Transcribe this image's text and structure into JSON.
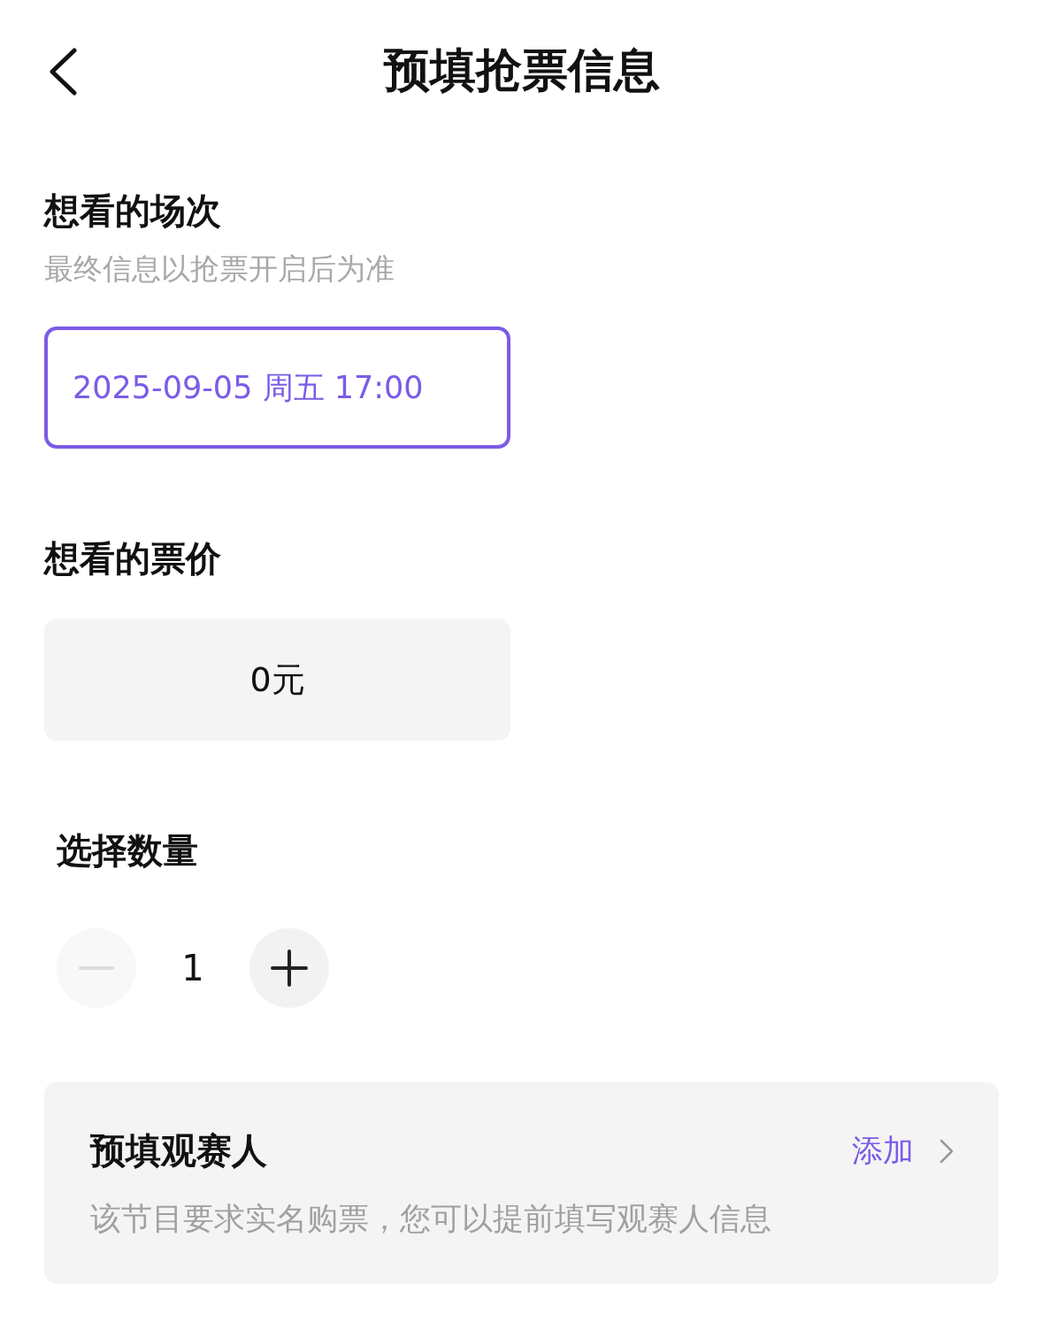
{
  "header": {
    "title": "预填抢票信息"
  },
  "session": {
    "title": "想看的场次",
    "subtitle": "最终信息以抢票开启后为准",
    "options": [
      {
        "label": "2025-09-05 周五 17:00",
        "selected": true
      }
    ]
  },
  "price": {
    "title": "想看的票价",
    "options": [
      {
        "label": "0元",
        "selected": false
      }
    ]
  },
  "quantity": {
    "title": "选择数量",
    "value": "1",
    "minus_disabled": true,
    "plus_disabled": false
  },
  "viewer": {
    "title": "预填观赛人",
    "action": "添加",
    "description": "该节目要求实名购票，您可以提前填写观赛人信息"
  }
}
